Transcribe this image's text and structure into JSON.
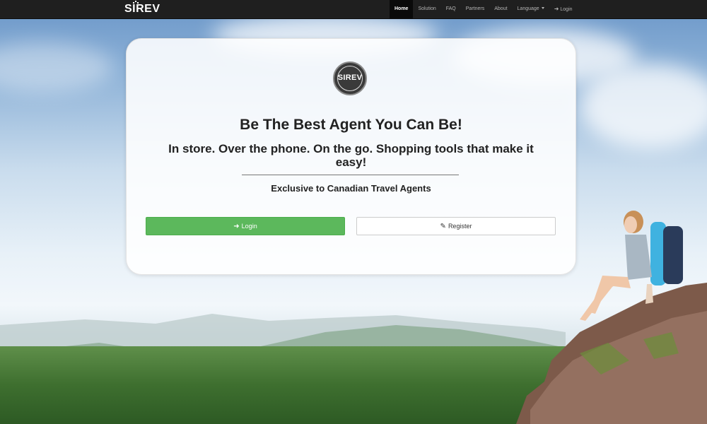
{
  "navbar": {
    "brand": "SIREV",
    "items": [
      {
        "label": "Home",
        "active": true
      },
      {
        "label": "Solution"
      },
      {
        "label": "FAQ"
      },
      {
        "label": "Partners"
      },
      {
        "label": "About"
      },
      {
        "label": "Language",
        "dropdown": true
      },
      {
        "label": "Login",
        "icon": "sign-in-icon"
      }
    ]
  },
  "card": {
    "logo_text": "SIREV",
    "headline": "Be The Best Agent You Can Be!",
    "subheadline": "In store. Over the phone. On the go. Shopping tools that make it easy!",
    "tagline": "Exclusive to Canadian Travel Agents",
    "login_button": {
      "label": "Login",
      "icon": "sign-in-icon"
    },
    "register_button": {
      "label": "Register",
      "icon": "pencil-icon"
    }
  },
  "colors": {
    "navbar_bg": "#1f1f1f",
    "login_button": "#5cb85c",
    "register_button": "#ffffff"
  }
}
